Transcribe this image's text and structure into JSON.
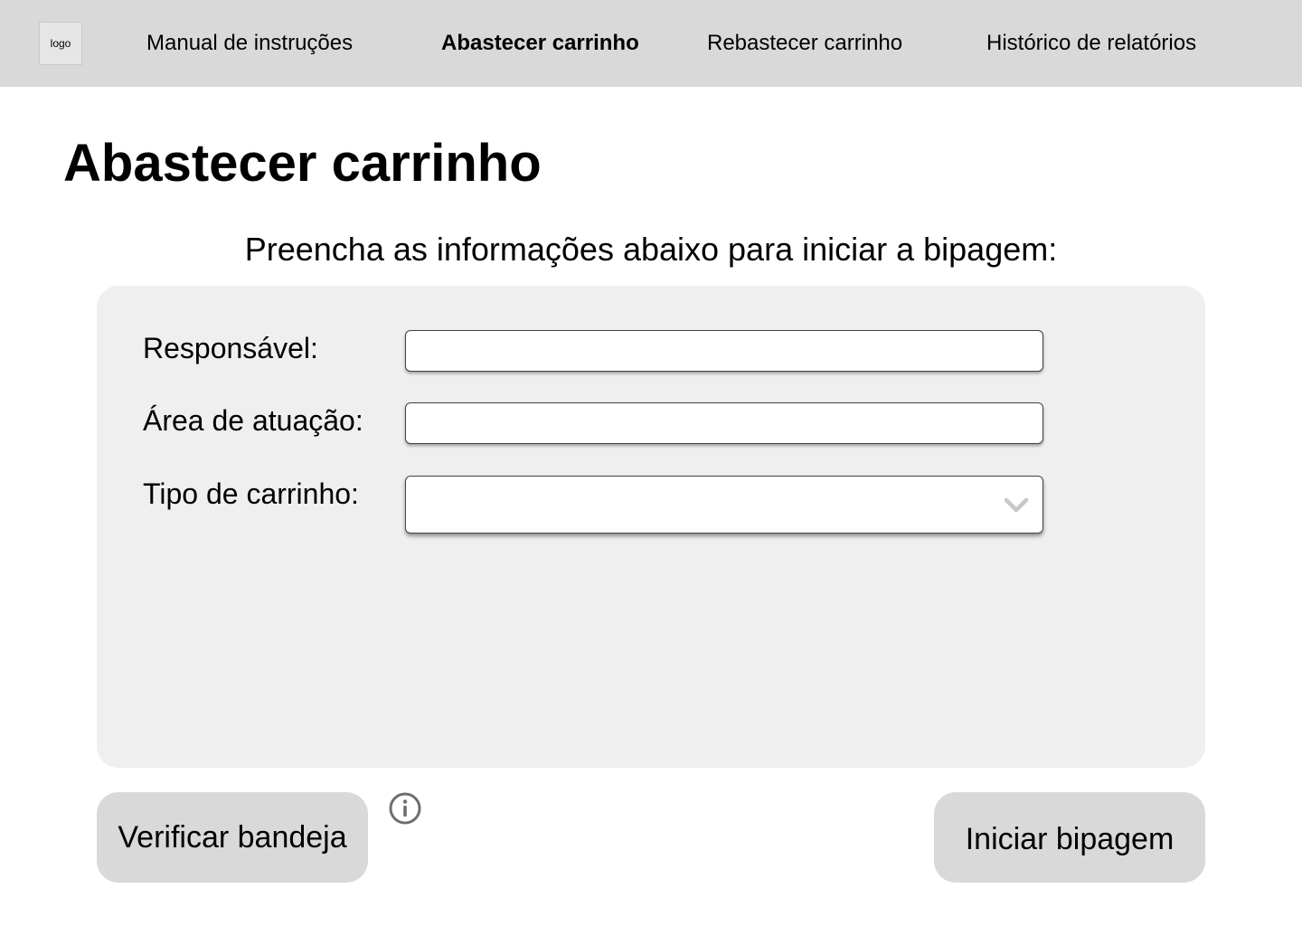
{
  "header": {
    "logo_text": "logo",
    "nav": [
      {
        "label": "Manual de instruções",
        "active": false
      },
      {
        "label": "Abastecer carrinho",
        "active": true
      },
      {
        "label": "Rebastecer carrinho",
        "active": false
      },
      {
        "label": "Histórico de relatórios",
        "active": false
      }
    ]
  },
  "main": {
    "title": "Abastecer carrinho",
    "subtitle": "Preencha as informações abaixo para iniciar a bipagem:"
  },
  "form": {
    "responsavel": {
      "label": "Responsável:",
      "value": ""
    },
    "area": {
      "label": "Área de atuação:",
      "value": ""
    },
    "tipo": {
      "label": "Tipo de carrinho:",
      "selected": ""
    }
  },
  "actions": {
    "verificar_label": "Verificar bandeja",
    "iniciar_label": "Iniciar bipagem"
  },
  "icons": {
    "info": "info-icon",
    "dropdown": "chevron-down-icon"
  },
  "colors": {
    "header_bg": "#d9d9d9",
    "panel_bg": "#efefef",
    "button_bg": "#d9d9d9",
    "chevron": "#c8c8c8",
    "info_icon": "#6e6e6e"
  }
}
